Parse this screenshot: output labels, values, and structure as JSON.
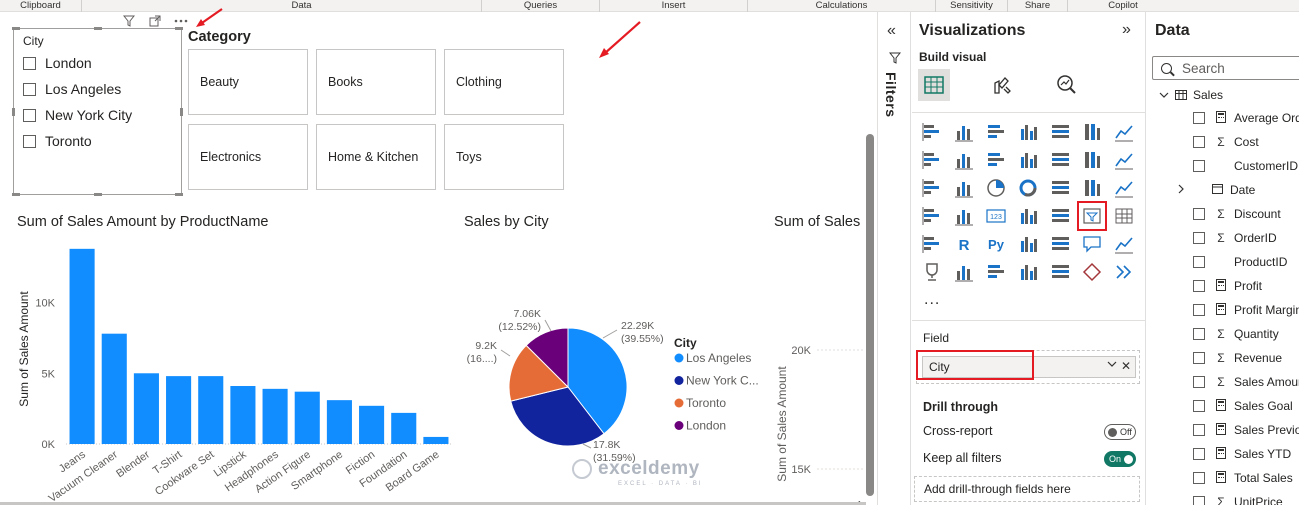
{
  "ribbon": {
    "groups": [
      "Clipboard",
      "Data",
      "Queries",
      "Insert",
      "Calculations",
      "Sensitivity",
      "Share",
      "Copilot"
    ]
  },
  "city_slicer": {
    "title": "City",
    "items": [
      "London",
      "Los Angeles",
      "New York City",
      "Toronto"
    ]
  },
  "category_slicer": {
    "title": "Category",
    "tiles": [
      "Beauty",
      "Books",
      "Clothing",
      "Electronics",
      "Home & Kitchen",
      "Toys"
    ]
  },
  "bar_chart": {
    "title": "Sum of Sales Amount by ProductName",
    "ylabel": "Sum of Sales Amount"
  },
  "pie_chart": {
    "title": "Sales by City",
    "legend_title": "City"
  },
  "third_chart": {
    "title": "Sum of Sales",
    "ylabel": "Sum of Sales Amount",
    "ticks": [
      "20K",
      "15K"
    ],
    "partial_label": "A"
  },
  "chart_data": [
    {
      "type": "bar",
      "title": "Sum of Sales Amount by ProductName",
      "xlabel": "",
      "ylabel": "Sum of Sales Amount",
      "categories": [
        "Jeans",
        "Vacuum Cleaner",
        "Blender",
        "T-Shirt",
        "Cookware Set",
        "Lipstick",
        "Headphones",
        "Action Figure",
        "Smartphone",
        "Fiction",
        "Foundation",
        "Board Game"
      ],
      "values": [
        13800,
        7800,
        5000,
        4800,
        4800,
        4100,
        3900,
        3700,
        3100,
        2700,
        2200,
        500
      ],
      "ylim": [
        0,
        14000
      ],
      "yticks": [
        0,
        5000,
        10000
      ],
      "ytick_labels": [
        "0K",
        "5K",
        "10K"
      ],
      "color": "#118dff",
      "grid": false
    },
    {
      "type": "pie",
      "title": "Sales by City",
      "legend_title": "City",
      "legend_position": "right",
      "slices": [
        {
          "name": "Los Angeles",
          "legend_label": "Los Angeles",
          "value": 22290,
          "label": "22.29K",
          "pct": "(39.55%)",
          "color": "#118dff"
        },
        {
          "name": "New York City",
          "legend_label": "New York C...",
          "value": 17800,
          "label": "17.8K",
          "pct": "(31.59%)",
          "color": "#12239e"
        },
        {
          "name": "Toronto",
          "legend_label": "Toronto",
          "value": 9200,
          "label": "9.2K",
          "pct": "(16....)",
          "color": "#e66c37"
        },
        {
          "name": "London",
          "legend_label": "London",
          "value": 7060,
          "label": "7.06K",
          "pct": "(12.52%)",
          "color": "#6b007b"
        }
      ]
    }
  ],
  "filters": {
    "label": "Filters"
  },
  "visualizations": {
    "title": "Visualizations",
    "build_visual": "Build visual",
    "more": "...",
    "field_label": "Field",
    "field_value": "City",
    "drill_through": "Drill through",
    "cross_report": "Cross-report",
    "cross_report_state": "Off",
    "keep_filters": "Keep all filters",
    "keep_filters_state": "On",
    "drill_placeholder": "Add drill-through fields here"
  },
  "data_pane": {
    "title": "Data",
    "search_placeholder": "Search",
    "table": "Sales",
    "fields": [
      {
        "name": "Average Order",
        "icon": "calc"
      },
      {
        "name": "Cost",
        "icon": "sigma"
      },
      {
        "name": "CustomerID",
        "icon": "none"
      },
      {
        "name": "Date",
        "icon": "calendar",
        "expandable": true
      },
      {
        "name": "Discount",
        "icon": "sigma"
      },
      {
        "name": "OrderID",
        "icon": "sigma"
      },
      {
        "name": "ProductID",
        "icon": "none"
      },
      {
        "name": "Profit",
        "icon": "calc"
      },
      {
        "name": "Profit Margin",
        "icon": "calc"
      },
      {
        "name": "Quantity",
        "icon": "sigma"
      },
      {
        "name": "Revenue",
        "icon": "sigma"
      },
      {
        "name": "Sales Amount",
        "icon": "sigma"
      },
      {
        "name": "Sales Goal",
        "icon": "calc"
      },
      {
        "name": "Sales Previous",
        "icon": "calc"
      },
      {
        "name": "Sales YTD",
        "icon": "calc"
      },
      {
        "name": "Total Sales",
        "icon": "calc"
      },
      {
        "name": "UnitPrice",
        "icon": "sigma"
      }
    ]
  },
  "watermark": {
    "text": "exceldemy",
    "sub": "EXCEL · DATA · BI"
  },
  "colors": {
    "accent_blue": "#118dff",
    "dark_blue": "#12239e",
    "orange": "#e66c37",
    "purple": "#6b007b",
    "highlight_red": "#e51b24",
    "toggle_on": "#117865"
  }
}
